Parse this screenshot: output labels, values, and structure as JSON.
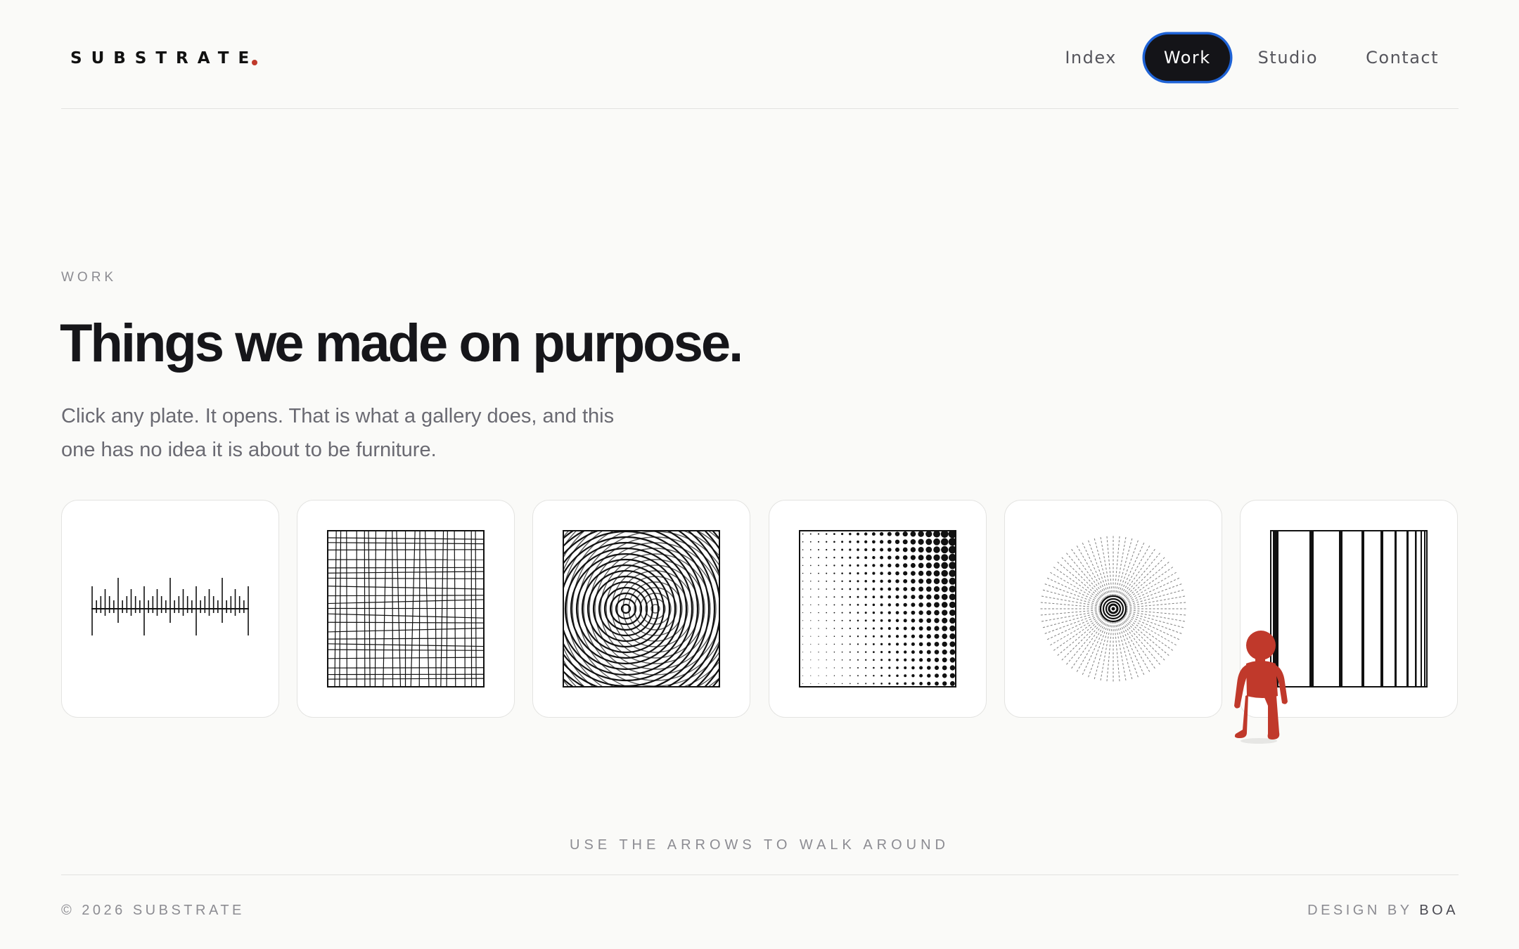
{
  "header": {
    "logo": "SUBSTRATE",
    "logo_dot_color": "#c0392b",
    "nav": [
      {
        "label": "Index",
        "active": false
      },
      {
        "label": "Work",
        "active": true
      },
      {
        "label": "Studio",
        "active": false
      },
      {
        "label": "Contact",
        "active": false
      }
    ]
  },
  "main": {
    "eyebrow": "WORK",
    "title": "Things we made on purpose.",
    "description": "Click any plate. It opens. That is what a gallery does, and this one has no idea it is about to be furniture.",
    "plates": [
      {
        "icon": "ruler-ticks-icon"
      },
      {
        "icon": "wobbly-grid-icon"
      },
      {
        "icon": "moire-circles-icon"
      },
      {
        "icon": "halftone-dots-icon"
      },
      {
        "icon": "radial-burst-icon"
      },
      {
        "icon": "vertical-stripes-icon"
      }
    ],
    "character": {
      "icon": "red-figure-icon",
      "color": "#c0392b"
    }
  },
  "hint": "USE THE ARROWS TO WALK AROUND",
  "footer": {
    "copyright": "© 2026 SUBSTRATE",
    "credit_prefix": "DESIGN BY",
    "credit_studio": "BOA"
  },
  "colors": {
    "background": "#fafaf8",
    "ink": "#16161a",
    "accent_ring": "#1f63d6",
    "muted": "#8c8c92"
  }
}
